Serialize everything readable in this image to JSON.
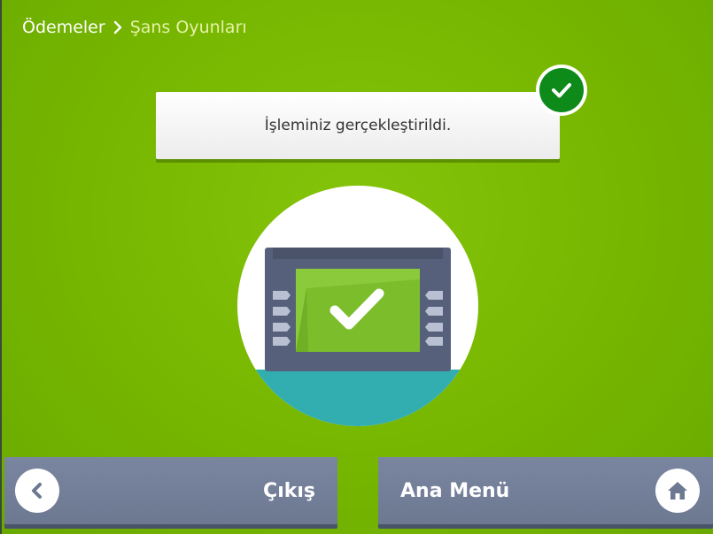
{
  "breadcrumb": {
    "parent": "Ödemeler",
    "current": "Şans Oyunları",
    "separator_icon": "chevron-right-icon"
  },
  "message": {
    "text": "İşleminiz gerçekleştirildi.",
    "status_icon": "check-circle-icon"
  },
  "illustration": {
    "icon": "atm-success-icon"
  },
  "buttons": {
    "exit_label": "Çıkış",
    "exit_icon": "chevron-left-icon",
    "home_label": "Ana Menü",
    "home_icon": "home-icon"
  },
  "colors": {
    "background": "#76b600",
    "success_badge": "#0d8a1a",
    "button": "#7a86a0",
    "breadcrumb_current": "#e6f1a8"
  }
}
